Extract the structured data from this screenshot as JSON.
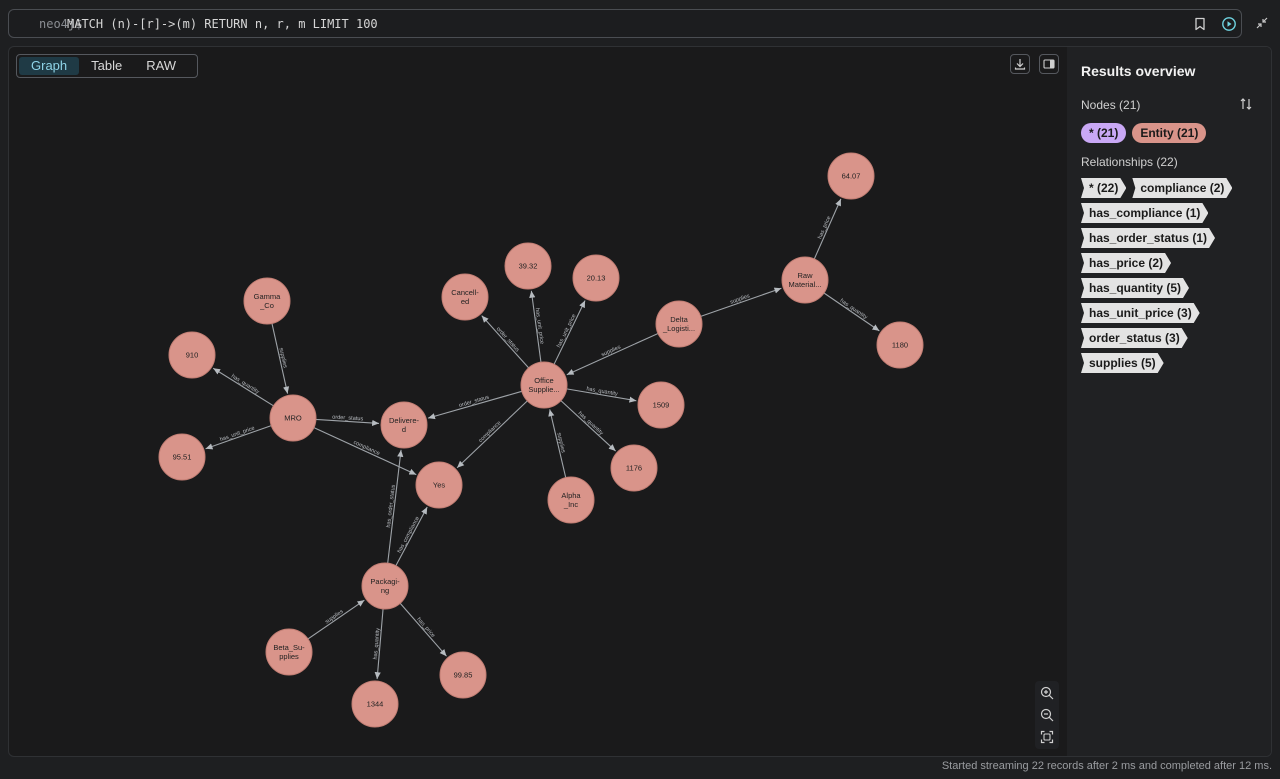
{
  "colors": {
    "accent": "#8fd4e8",
    "node_fill": "#d9948a",
    "edge": "#9ea3a8",
    "chip_all_nodes": "#c9a8f5",
    "chip_entity": "#d9948a",
    "chip_rel": "#e3e3e3",
    "window_red": "#fe5f57",
    "window_yellow": "#febc2e",
    "window_green": "#28c840"
  },
  "query": {
    "prompt": "neo4j$",
    "text": "MATCH (n)-[r]->(m) RETURN n, r, m LIMIT 100",
    "bookmark_icon": "bookmark-icon",
    "run_icon": "play-circle-icon"
  },
  "view_tabs": [
    "Graph",
    "Table",
    "RAW"
  ],
  "active_tab": "Graph",
  "toolbar_icons": [
    "download-icon",
    "sidebar-toggle-icon"
  ],
  "sidebar": {
    "title": "Results overview",
    "nodes_label": "Nodes (21)",
    "node_chips": [
      {
        "label": "* (21)",
        "color": "#c9a8f5"
      },
      {
        "label": "Entity (21)",
        "color": "#d9948a"
      }
    ],
    "relationships_label": "Relationships (22)",
    "rel_chips": [
      "* (22)",
      "compliance (2)",
      "has_compliance (1)",
      "has_order_status (1)",
      "has_price (2)",
      "has_quantity (5)",
      "has_unit_price (3)",
      "order_status (3)",
      "supplies (5)"
    ]
  },
  "zoom_icons": [
    "zoom-in-icon",
    "zoom-out-icon",
    "fit-to-screen-icon"
  ],
  "status": "Started streaming 22 records after 2 ms and completed after 12 ms.",
  "graph": {
    "nodes": [
      {
        "id": "n64",
        "label": [
          "64.07"
        ]
      },
      {
        "id": "raw",
        "label": [
          "Raw",
          "Material..."
        ]
      },
      {
        "id": "n1180",
        "label": [
          "1180"
        ]
      },
      {
        "id": "delta",
        "label": [
          "Delta",
          "_Logisti..."
        ]
      },
      {
        "id": "n3932",
        "label": [
          "39.32"
        ]
      },
      {
        "id": "n2013",
        "label": [
          "20.13"
        ]
      },
      {
        "id": "canc",
        "label": [
          "Cancell-",
          "ed"
        ]
      },
      {
        "id": "office",
        "label": [
          "Office",
          "Supplie..."
        ]
      },
      {
        "id": "n1509",
        "label": [
          "1509"
        ]
      },
      {
        "id": "n1176",
        "label": [
          "1176"
        ]
      },
      {
        "id": "alpha",
        "label": [
          "Alpha",
          "_Inc"
        ]
      },
      {
        "id": "gamma",
        "label": [
          "Gamma",
          "_Co"
        ]
      },
      {
        "id": "n910",
        "label": [
          "910"
        ]
      },
      {
        "id": "mro",
        "label": [
          "MRO"
        ]
      },
      {
        "id": "deliv",
        "label": [
          "Delivere-",
          "d"
        ]
      },
      {
        "id": "n9551",
        "label": [
          "95.51"
        ]
      },
      {
        "id": "yes",
        "label": [
          "Yes"
        ]
      },
      {
        "id": "pack",
        "label": [
          "Packagi-",
          "ng"
        ]
      },
      {
        "id": "beta",
        "label": [
          "Beta_Su-",
          "pplies"
        ]
      },
      {
        "id": "n1344",
        "label": [
          "1344"
        ]
      },
      {
        "id": "n9985",
        "label": [
          "99.85"
        ]
      }
    ],
    "edges": [
      {
        "from": "raw",
        "to": "n64",
        "label": "has_price"
      },
      {
        "from": "raw",
        "to": "n1180",
        "label": "has_quantity"
      },
      {
        "from": "delta",
        "to": "raw",
        "label": "supplies"
      },
      {
        "from": "delta",
        "to": "office",
        "label": "supplies"
      },
      {
        "from": "office",
        "to": "n3932",
        "label": "has_unit_price"
      },
      {
        "from": "office",
        "to": "n2013",
        "label": "has_unit_price"
      },
      {
        "from": "office",
        "to": "canc",
        "label": "order_status"
      },
      {
        "from": "office",
        "to": "n1509",
        "label": "has_quantity"
      },
      {
        "from": "office",
        "to": "n1176",
        "label": "has_quantity"
      },
      {
        "from": "alpha",
        "to": "office",
        "label": "supplies"
      },
      {
        "from": "office",
        "to": "deliv",
        "label": "order_status"
      },
      {
        "from": "office",
        "to": "yes",
        "label": "compliance"
      },
      {
        "from": "gamma",
        "to": "mro",
        "label": "supplies"
      },
      {
        "from": "mro",
        "to": "n910",
        "label": "has_quantity"
      },
      {
        "from": "mro",
        "to": "deliv",
        "label": "order_status"
      },
      {
        "from": "mro",
        "to": "n9551",
        "label": "has_unit_price"
      },
      {
        "from": "mro",
        "to": "yes",
        "label": "compliance"
      },
      {
        "from": "pack",
        "to": "deliv",
        "label": "has_order_status"
      },
      {
        "from": "pack",
        "to": "yes",
        "label": "has_compliance"
      },
      {
        "from": "beta",
        "to": "pack",
        "label": "supplies"
      },
      {
        "from": "pack",
        "to": "n1344",
        "label": "has_quantity"
      },
      {
        "from": "pack",
        "to": "n9985",
        "label": "has_price"
      }
    ]
  }
}
